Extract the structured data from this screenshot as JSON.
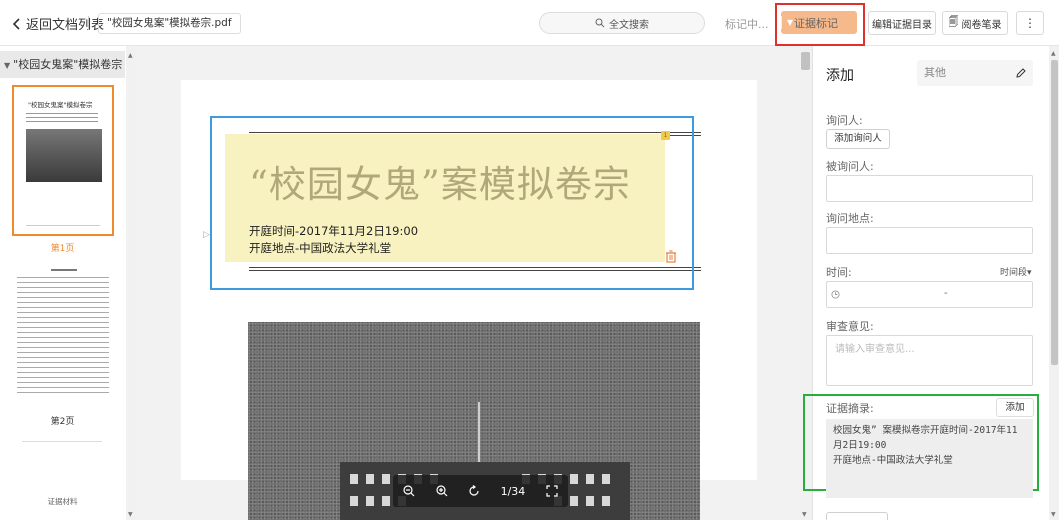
{
  "topbar": {
    "back_label": "返回文档列表",
    "file_tab": "\"校园女鬼案\"模拟卷宗.pdf",
    "search_label": "全文搜索",
    "marking_status": "标记中...",
    "evidence_mark_label": "证据标记",
    "edit_catalog_label": "编辑证据目录",
    "reading_notes_label": "阅卷笔录",
    "more_label": "⋮"
  },
  "sidebar": {
    "tree_title": "\"校园女鬼案\"模拟卷宗",
    "thumb1_title": "\"校园女鬼案\"模拟卷宗",
    "page1_caption": "第1页",
    "page2_caption": "第2页",
    "page3_caption": "证据材料"
  },
  "document": {
    "title": "“校园女鬼”案模拟卷宗",
    "open_time": "开庭时间-2017年11月2日19:00",
    "location": "开庭地点-中国政法大学礼堂",
    "note_badge": "1"
  },
  "zoombar": {
    "page_indicator": "1/34"
  },
  "panel": {
    "title": "添加",
    "category": "其他",
    "interrogator_label": "询问人:",
    "add_interrogator_label": "添加询问人",
    "interrogatee_label": "被询问人:",
    "place_label": "询问地点:",
    "time_label": "时间:",
    "time_range_label": "时间段",
    "time_separator": "-",
    "opinion_label": "审查意见:",
    "opinion_placeholder": "请输入审查意见...",
    "excerpt_label": "证据摘录:",
    "excerpt_add_label": "添加",
    "excerpt_line1": "校园女鬼” 案模拟卷宗开庭时间-2017年11",
    "excerpt_line2": "月2日19:00",
    "excerpt_line3": "开庭地点-中国政法大学礼堂"
  },
  "colors": {
    "accent_orange": "#ef8a2f",
    "evidence_button": "#f5b98b",
    "highlight_red": "#e0302b",
    "highlight_blue": "#3e9be0",
    "highlight_green": "#27ae3e",
    "sticky_note": "#f8f2c0"
  }
}
